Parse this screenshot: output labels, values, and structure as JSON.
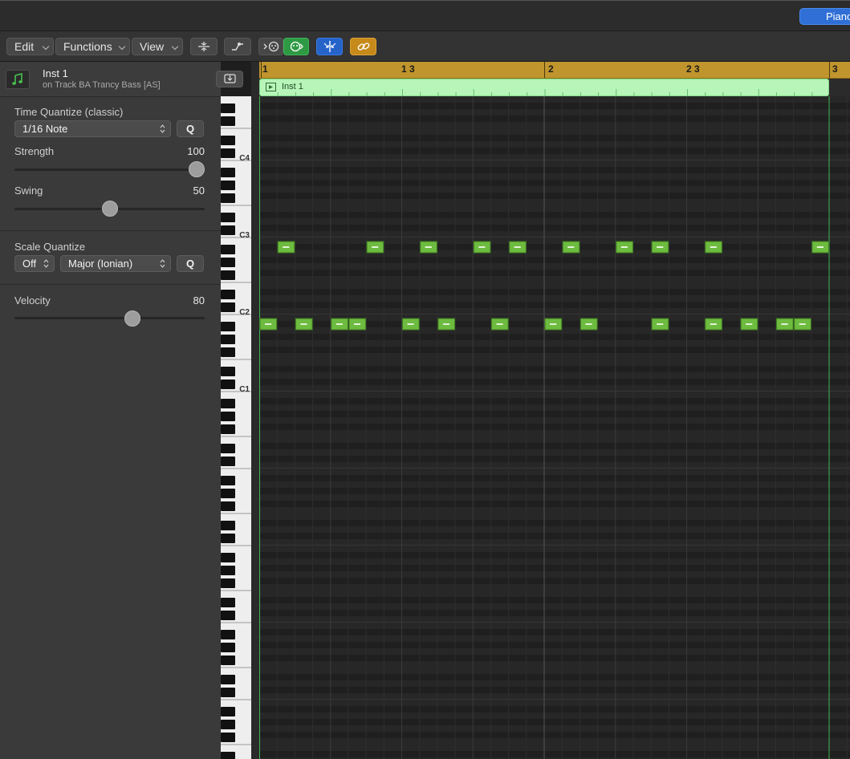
{
  "header": {
    "piano_tab_label": "Piano Roll"
  },
  "toolbar": {
    "edit_label": "Edit",
    "functions_label": "Functions",
    "view_label": "View",
    "icons": [
      "collapse-icon",
      "automation-curve-icon",
      "midi-in-icon",
      "capture-icon",
      "snap-icon",
      "link-icon"
    ]
  },
  "region": {
    "name": "Inst 1",
    "track": "on Track BA Trancy Bass [AS]"
  },
  "time_quantize": {
    "label": "Time Quantize (classic)",
    "value": "1/16 Note",
    "q_label": "Q",
    "strength_label": "Strength",
    "strength_value": "100",
    "strength_fraction": 1.0,
    "swing_label": "Swing",
    "swing_value": "50",
    "swing_fraction": 0.5
  },
  "scale_quantize": {
    "label": "Scale Quantize",
    "off_value": "Off",
    "scale_value": "Major (Ionian)",
    "q_label": "Q"
  },
  "velocity": {
    "label": "Velocity",
    "value": "80",
    "fraction": 0.63
  },
  "ruler": {
    "labels": [
      "1",
      "1 3",
      "2",
      "2 3",
      "3"
    ]
  },
  "region_strip": {
    "label": "Inst 1"
  },
  "octave_labels": [
    "C4",
    "C3",
    "C2",
    "C1"
  ],
  "colors": {
    "note_fill": "#6dbb3f",
    "ruler": "#c0952d",
    "region": "#b7f5b9",
    "piano_tab": "#2f6fd6"
  },
  "notes": {
    "upper_pitch": "A#2",
    "upper_starts_16ths": [
      1,
      6,
      9,
      12,
      14,
      17,
      20,
      22,
      25,
      31
    ],
    "lower_pitch": "A#1",
    "lower_starts_16ths": [
      0,
      2,
      4,
      5,
      8,
      10,
      13,
      16,
      18,
      22,
      25,
      27,
      29,
      30
    ]
  }
}
